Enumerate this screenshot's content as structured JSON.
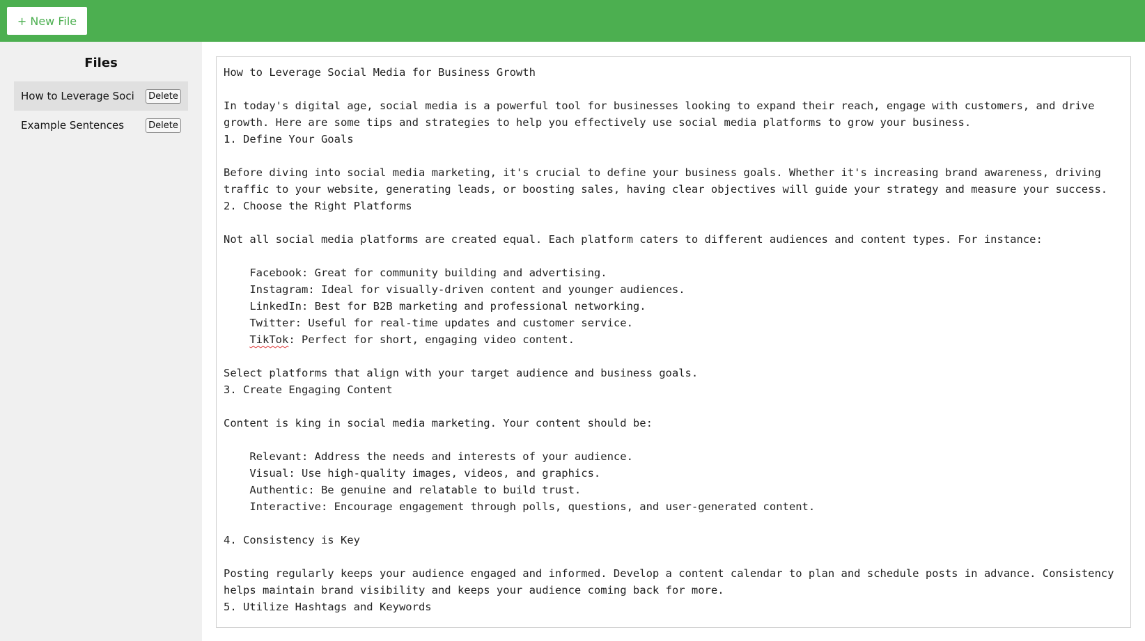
{
  "toolbar": {
    "new_file_label": "+ New File"
  },
  "sidebar": {
    "title": "Files",
    "files": [
      {
        "name": "How to Leverage Soci",
        "delete_label": "Delete",
        "active": true
      },
      {
        "name": "Example Sentences",
        "delete_label": "Delete",
        "active": false
      }
    ]
  },
  "editor": {
    "part1": "How to Leverage Social Media for Business Growth\n\nIn today's digital age, social media is a powerful tool for businesses looking to expand their reach, engage with customers, and drive growth. Here are some tips and strategies to help you effectively use social media platforms to grow your business.\n1. Define Your Goals\n\nBefore diving into social media marketing, it's crucial to define your business goals. Whether it's increasing brand awareness, driving traffic to your website, generating leads, or boosting sales, having clear objectives will guide your strategy and measure your success.\n2. Choose the Right Platforms\n\nNot all social media platforms are created equal. Each platform caters to different audiences and content types. For instance:\n\n    Facebook: Great for community building and advertising.\n    Instagram: Ideal for visually-driven content and younger audiences.\n    LinkedIn: Best for B2B marketing and professional networking.\n    Twitter: Useful for real-time updates and customer service.\n    ",
    "misspelled_word": "TikTok",
    "part2": ": Perfect for short, engaging video content.\n\nSelect platforms that align with your target audience and business goals.\n3. Create Engaging Content\n\nContent is king in social media marketing. Your content should be:\n\n    Relevant: Address the needs and interests of your audience.\n    Visual: Use high-quality images, videos, and graphics.\n    Authentic: Be genuine and relatable to build trust.\n    Interactive: Encourage engagement through polls, questions, and user-generated content.\n\n4. Consistency is Key\n\nPosting regularly keeps your audience engaged and informed. Develop a content calendar to plan and schedule posts in advance. Consistency helps maintain brand visibility and keeps your audience coming back for more.\n5. Utilize Hashtags and Keywords"
  },
  "colors": {
    "accent": "#4caf50",
    "sidebar_bg": "#f0f0f0",
    "active_item_bg": "#e0e0e0"
  }
}
